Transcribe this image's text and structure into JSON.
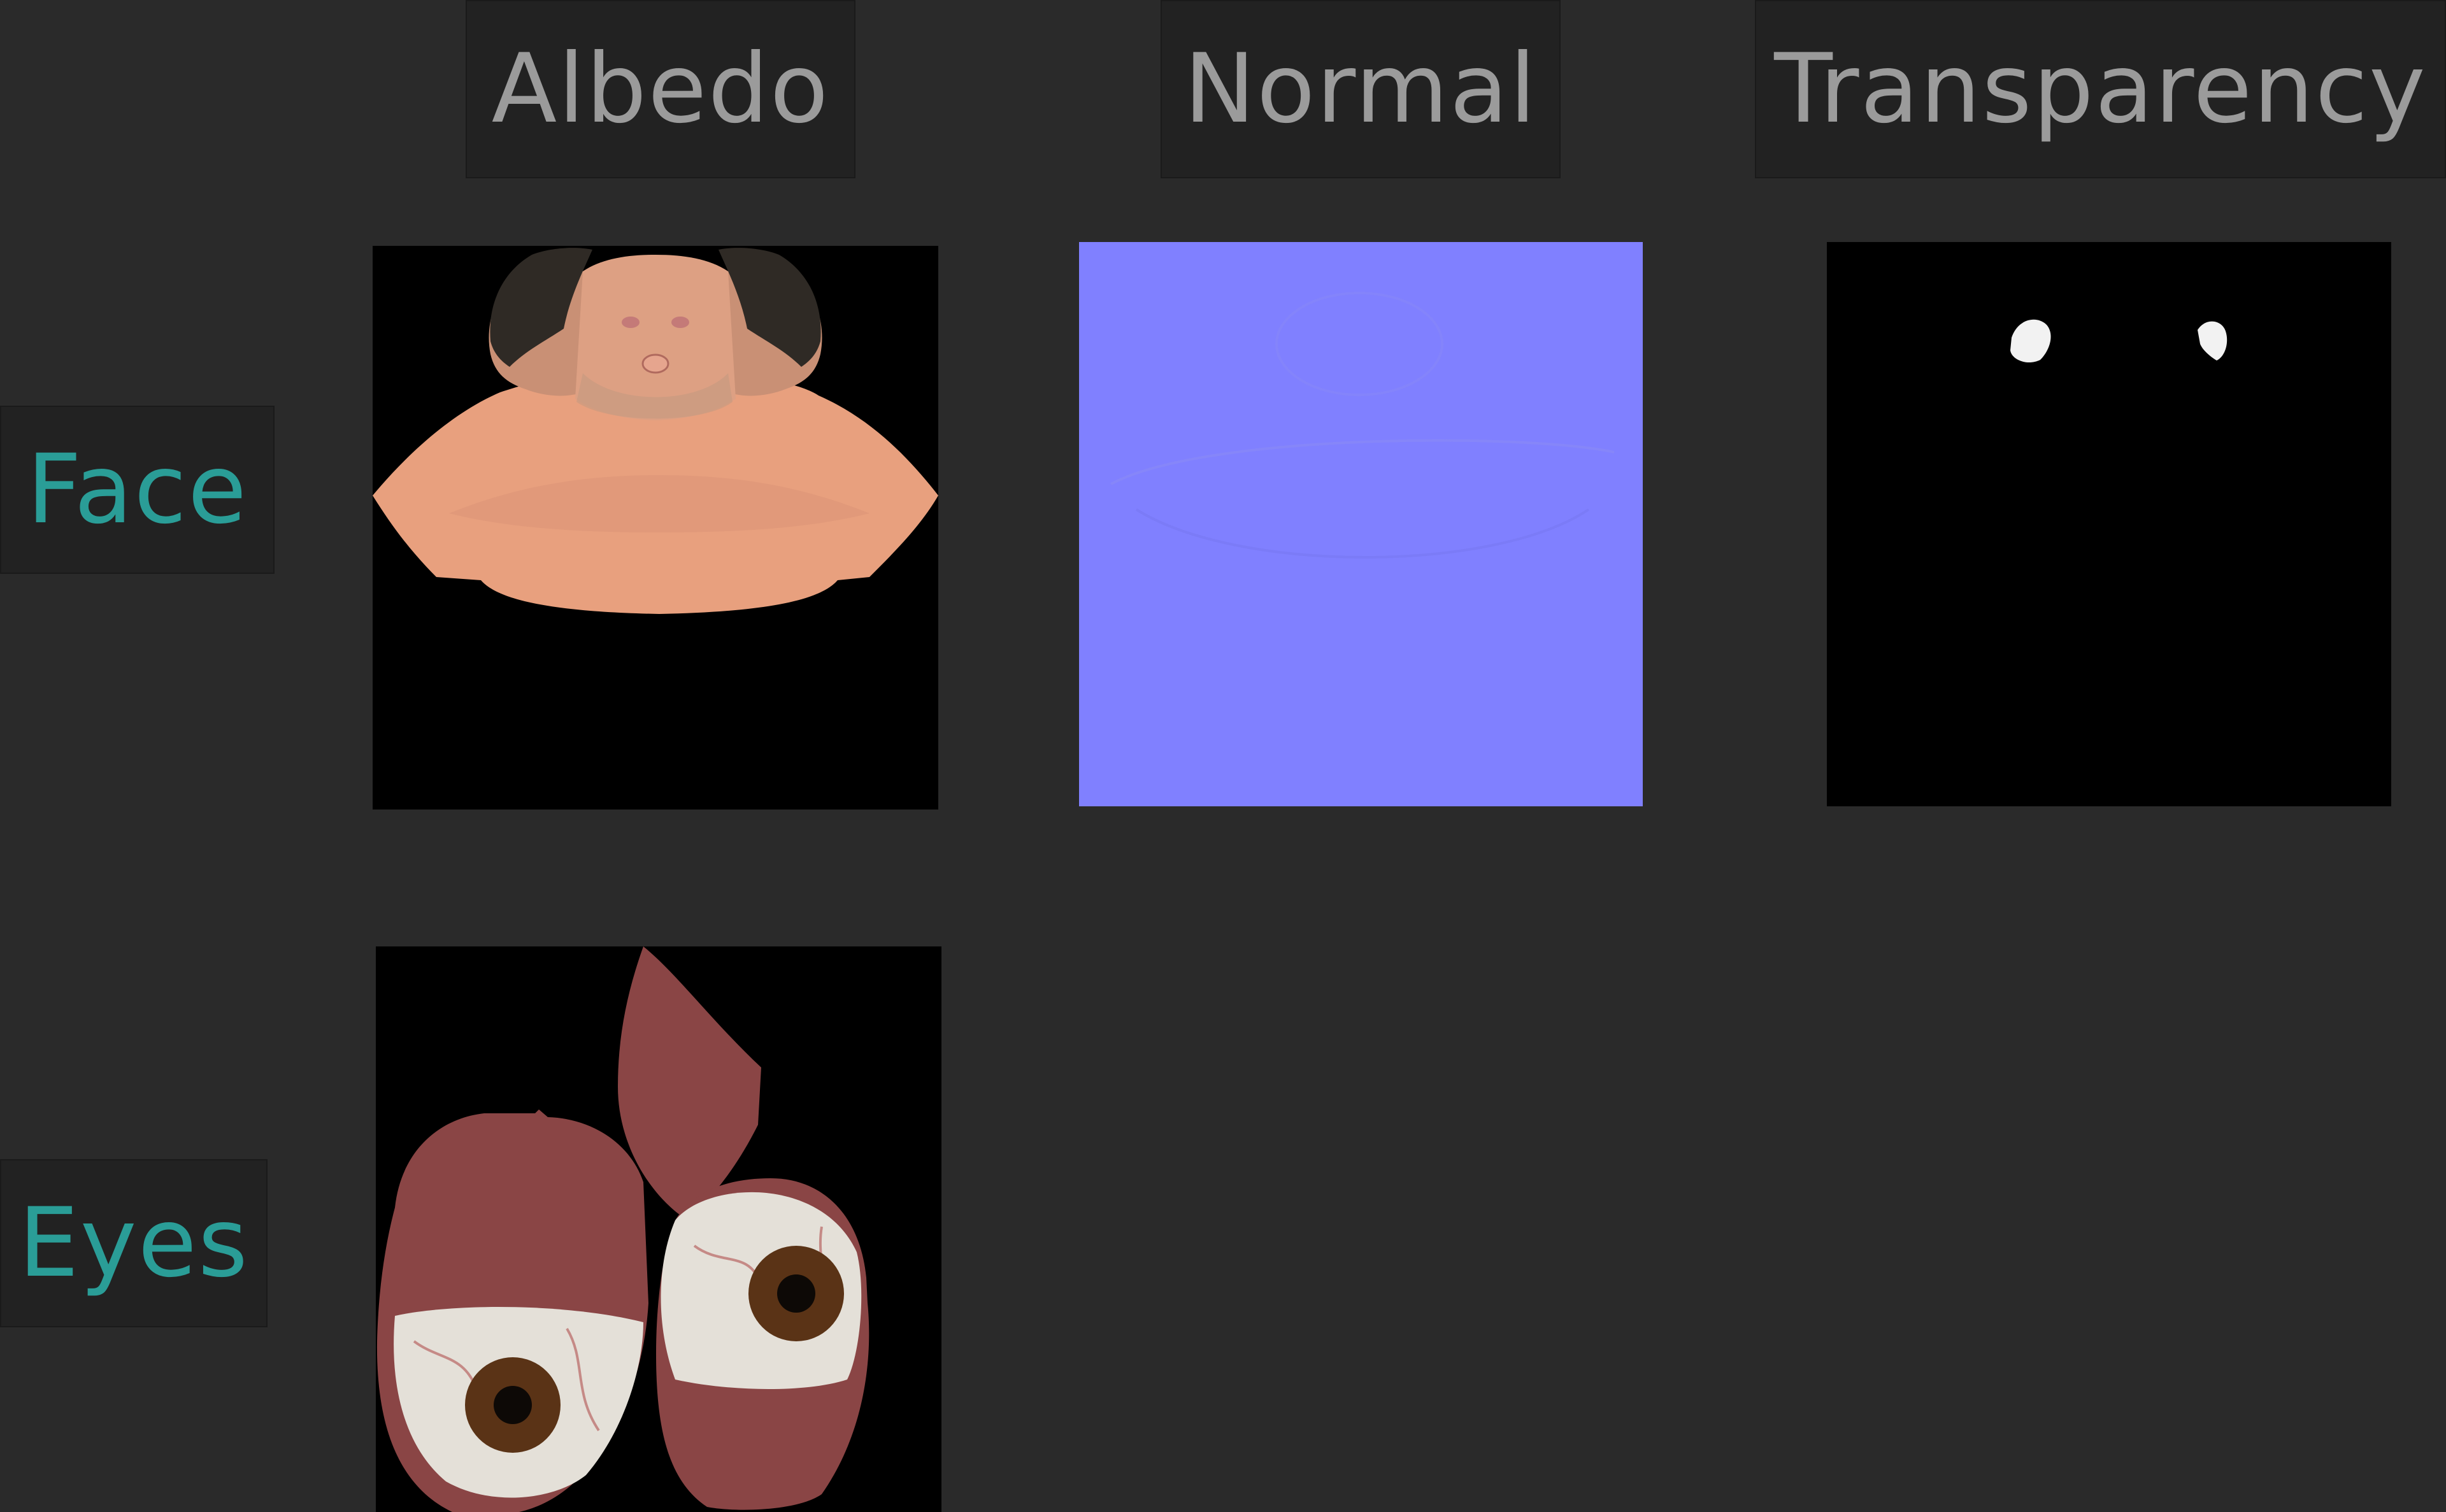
{
  "columns": {
    "albedo": "Albedo",
    "normal": "Normal",
    "transparency": "Transparency"
  },
  "rows": {
    "face": "Face",
    "eyes": "Eyes"
  },
  "colors": {
    "background": "#2a2a2a",
    "column_label_text": "#9b9b9b",
    "row_label_text": "#2a9d97",
    "label_box": "#222222",
    "skin": "#e8a07e",
    "hair": "#2f2a25",
    "normal_map": "#8080ff",
    "eye_flesh": "#8a4545",
    "sclera": "#e4e0d8",
    "iris": "#5a3316"
  }
}
